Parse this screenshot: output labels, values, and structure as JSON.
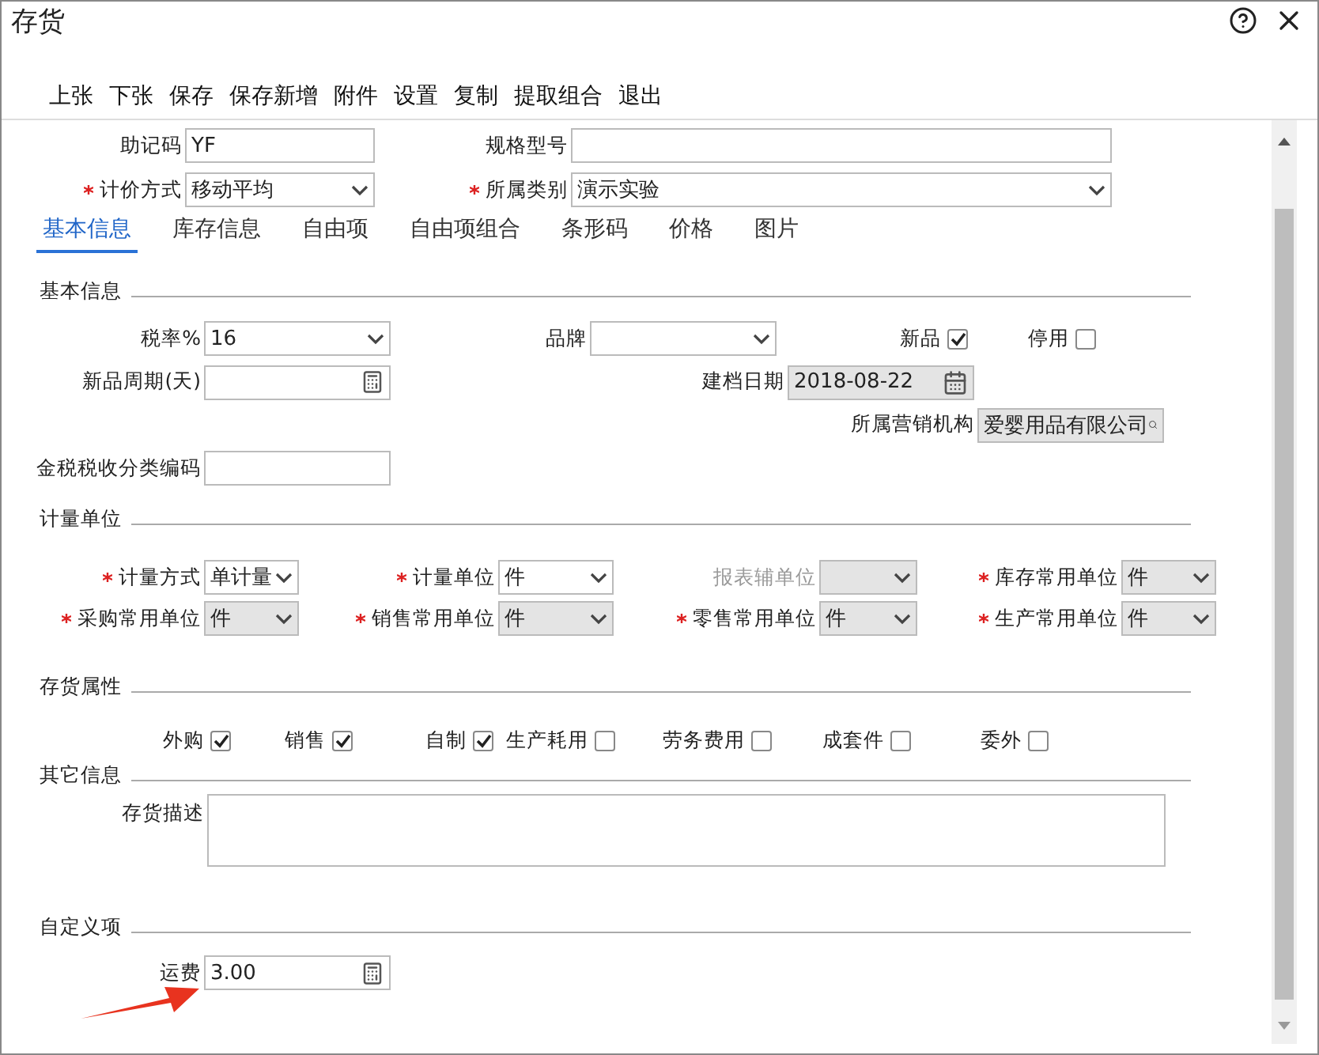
{
  "window": {
    "title": "存货"
  },
  "toolbar": [
    "上张",
    "下张",
    "保存",
    "保存新增",
    "附件",
    "设置",
    "复制",
    "提取组合",
    "退出"
  ],
  "header_fields": [
    {
      "label": "助记码",
      "required": false,
      "kind": "text",
      "value": "YF"
    },
    {
      "label": "规格型号",
      "required": false,
      "kind": "text"
    },
    {
      "label": "计价方式",
      "required": true,
      "kind": "select",
      "value": "移动平均"
    },
    {
      "label": "所属类别",
      "required": true,
      "kind": "select",
      "value": "演示实验"
    }
  ],
  "tabs": [
    {
      "label": "基本信息",
      "selected": true
    },
    {
      "label": "库存信息",
      "selected": false
    },
    {
      "label": "自由项",
      "selected": false
    },
    {
      "label": "自由项组合",
      "selected": false
    },
    {
      "label": "条形码",
      "selected": false
    },
    {
      "label": "价格",
      "selected": false
    },
    {
      "label": "图片",
      "selected": false
    }
  ],
  "basic": {
    "title": "基本信息",
    "fields": [
      {
        "label": "税率%",
        "kind": "select",
        "value": "16",
        "disabled": false
      },
      {
        "label": "品牌",
        "kind": "select",
        "disabled": false
      },
      {
        "label": "新品周期(天)",
        "kind": "calc",
        "disabled": false
      },
      {
        "label": "建档日期",
        "kind": "date",
        "value": "2018-08-22",
        "disabled": true
      },
      {
        "label": "所属营销机构",
        "kind": "lookup",
        "value": "爱婴用品有限公司",
        "disabled": true
      },
      {
        "label": "金税税收分类编码",
        "kind": "text",
        "disabled": false
      }
    ],
    "flags": [
      {
        "label": "新品",
        "checked": true
      },
      {
        "label": "停用",
        "checked": false
      }
    ]
  },
  "units": {
    "title": "计量单位",
    "fields": [
      {
        "label": "计量方式",
        "required": true,
        "value": "单计量",
        "disabled": false
      },
      {
        "label": "计量单位",
        "required": true,
        "value": "件",
        "disabled": false
      },
      {
        "label": "报表辅单位",
        "required": false,
        "disabled": true
      },
      {
        "label": "库存常用单位",
        "required": true,
        "value": "件",
        "disabled": true
      },
      {
        "label": "采购常用单位",
        "required": true,
        "value": "件",
        "disabled": true
      },
      {
        "label": "销售常用单位",
        "required": true,
        "value": "件",
        "disabled": true
      },
      {
        "label": "零售常用单位",
        "required": true,
        "value": "件",
        "disabled": true
      },
      {
        "label": "生产常用单位",
        "required": true,
        "value": "件",
        "disabled": true
      }
    ]
  },
  "attributes": {
    "title": "存货属性",
    "items": [
      {
        "label": "外购",
        "checked": true
      },
      {
        "label": "销售",
        "checked": true
      },
      {
        "label": "自制",
        "checked": true
      },
      {
        "label": "生产耗用",
        "checked": false
      },
      {
        "label": "劳务费用",
        "checked": false
      },
      {
        "label": "成套件",
        "checked": false
      },
      {
        "label": "委外",
        "checked": false
      }
    ]
  },
  "other": {
    "title": "其它信息",
    "description_label": "存货描述"
  },
  "custom": {
    "title": "自定义项",
    "fields": [
      {
        "label": "运费",
        "kind": "calc",
        "value": "3.00"
      }
    ]
  }
}
